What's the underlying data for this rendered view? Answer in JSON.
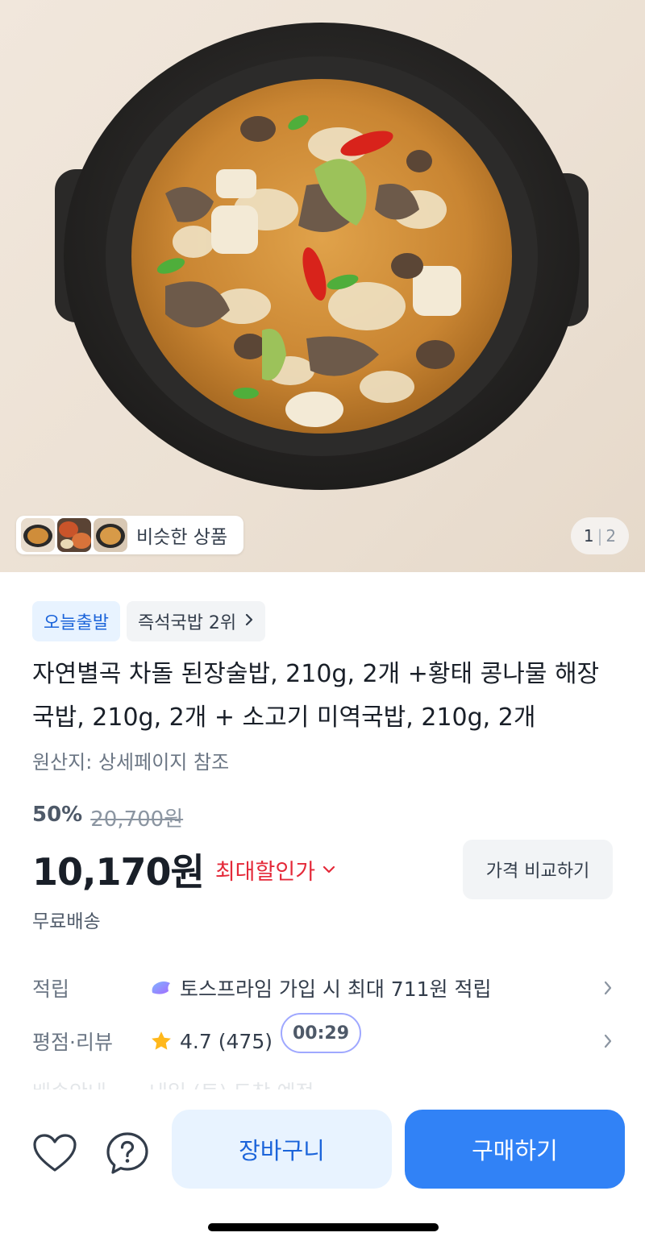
{
  "hero": {
    "similar_label": "비슷한 상품",
    "page_current": "1",
    "page_total": "2"
  },
  "badges": {
    "today_ship": "오늘출발",
    "ranking": "즉석국밥 2위"
  },
  "product": {
    "title": "자연별곡 차돌 된장술밥, 210g, 2개 +황태 콩나물 해장국밥, 210g, 2개 + 소고기 미역국밥, 210g, 2개",
    "origin": "원산지: 상세페이지 참조"
  },
  "pricing": {
    "discount_rate": "50%",
    "original_price": "20,700원",
    "price": "10,170원",
    "max_discount_label": "최대할인가",
    "compare_label": "가격 비교하기",
    "shipping": "무료배송"
  },
  "rows": {
    "points_label": "적립",
    "points_text": "토스프라임 가입 시 최대 711원 적립",
    "rating_label": "평점·리뷰",
    "rating_value": "4.7",
    "review_count": "(475)",
    "timer": "00:29",
    "delivery_label": "배송안내",
    "delivery_text": "내일 (토) 도착 예정"
  },
  "actions": {
    "cart": "장바구니",
    "buy": "구매하기"
  },
  "colors": {
    "primary": "#3182f6",
    "primary_light": "#e8f3ff",
    "discount_red": "#e42939",
    "star": "#ffb81c"
  },
  "icons": [
    "heart-icon",
    "help-icon",
    "chevron-right-icon",
    "chevron-down-icon",
    "star-icon",
    "toss-prime-icon"
  ]
}
